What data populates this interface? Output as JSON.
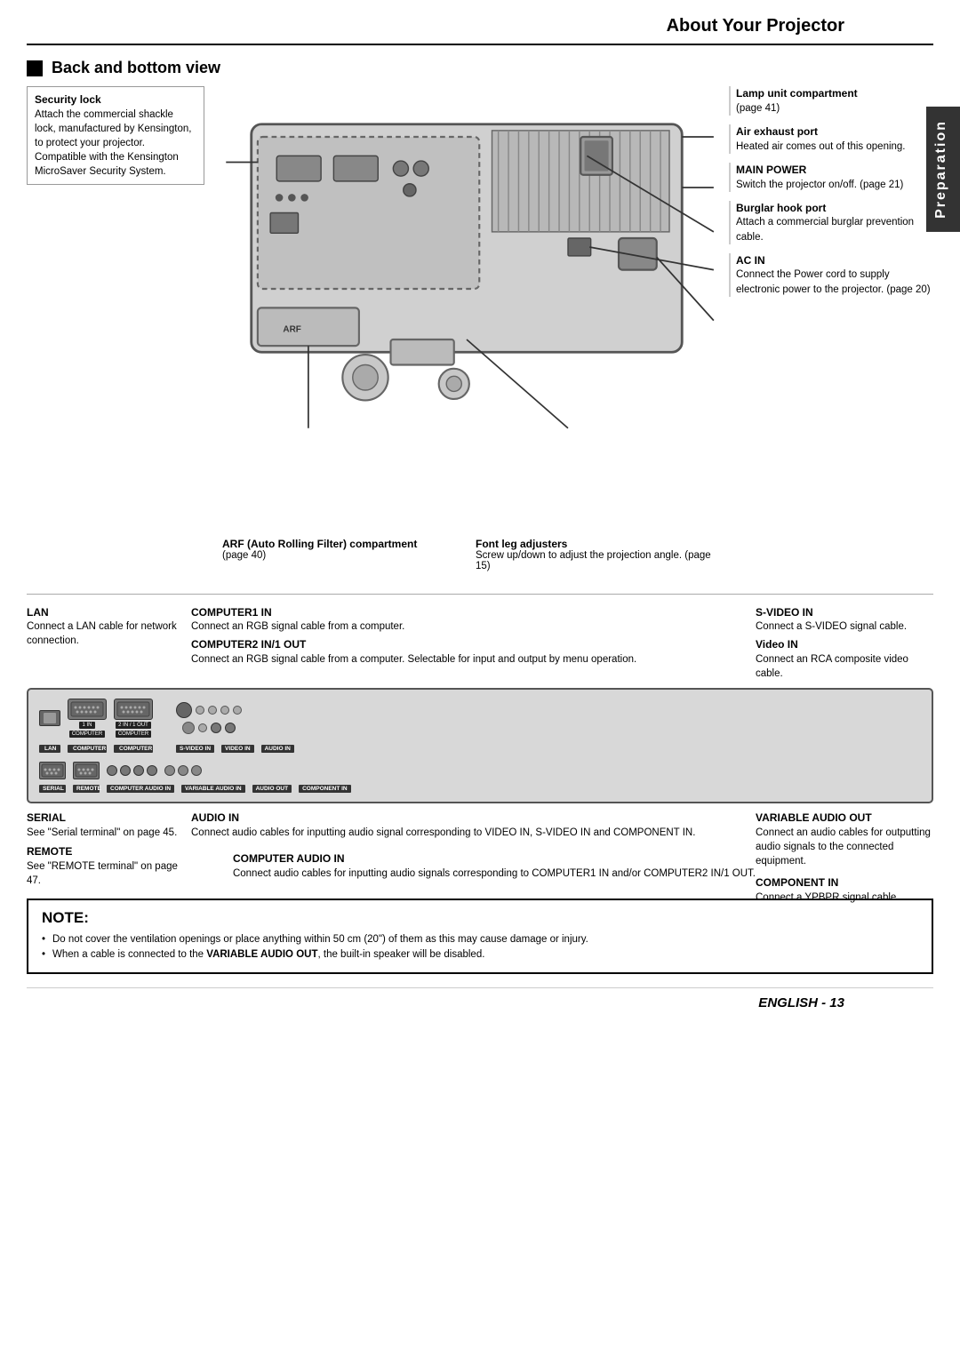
{
  "header": {
    "title": "About Your Projector"
  },
  "side_tab": {
    "label": "Preparation"
  },
  "section": {
    "title": "Back and bottom view"
  },
  "left_annotations": [
    {
      "id": "security-lock",
      "title": "Security lock",
      "text": "Attach the commercial shackle lock, manufactured by Kensington, to protect your projector. Compatible with the Kensington MicroSaver Security System."
    }
  ],
  "right_annotations": [
    {
      "id": "lamp-unit",
      "title": "Lamp unit compartment",
      "text": "(page 41)"
    },
    {
      "id": "air-exhaust",
      "title": "Air exhaust port",
      "text": "Heated air comes out of this opening."
    },
    {
      "id": "main-power",
      "title": "MAIN POWER",
      "text": "Switch the projector on/off. (page 21)"
    },
    {
      "id": "burglar-hook",
      "title": "Burglar hook port",
      "text": "Attach a commercial burglar prevention cable."
    },
    {
      "id": "ac-in",
      "title": "AC IN",
      "text": "Connect the Power cord to supply electronic power to the projector. (page 20)"
    }
  ],
  "bottom_labels": [
    {
      "id": "arf",
      "title": "ARF (Auto Rolling Filter) compartment",
      "text": "(page 40)"
    },
    {
      "id": "font-leg",
      "title": "Font leg adjusters",
      "text": "Screw up/down to adjust the projection angle. (page 15)"
    }
  ],
  "connector_top_labels": [
    {
      "id": "lan",
      "title": "LAN",
      "text": "Connect a LAN cable for network connection."
    },
    {
      "id": "computer1in",
      "title": "COMPUTER1 IN",
      "text": "Connect an RGB signal cable from a computer."
    },
    {
      "id": "computer2",
      "title": "COMPUTER2 IN/1 OUT",
      "text": "Connect an RGB signal cable from a computer. Selectable for input and output by menu operation."
    },
    {
      "id": "svideo",
      "title": "S-VIDEO IN",
      "text": "Connect a S-VIDEO signal cable."
    },
    {
      "id": "videoin",
      "title": "Video IN",
      "text": "Connect an RCA composite video cable."
    }
  ],
  "connector_bottom_labels": [
    {
      "id": "serial",
      "title": "SERIAL",
      "text": "See \"Serial terminal\" on page 45."
    },
    {
      "id": "remote",
      "title": "REMOTE",
      "text": "See \"REMOTE terminal\" on page 47."
    },
    {
      "id": "audio-in-label",
      "title": "AUDIO IN",
      "text": "Connect audio cables for inputting audio signal corresponding to VIDEO IN, S-VIDEO IN and COMPONENT IN."
    },
    {
      "id": "computer-audio-in",
      "title": "COMPUTER AUDIO IN",
      "text": "Connect audio cables for inputting audio signals corresponding to COMPUTER1 IN and/or COMPUTER2 IN/1 OUT."
    },
    {
      "id": "variable-audio-out",
      "title": "VARIABLE AUDIO OUT",
      "text": "Connect an audio cables for outputting audio signals to the connected equipment."
    },
    {
      "id": "component-in",
      "title": "COMPONENT IN",
      "text": "Connect a YPBPR signal cable."
    }
  ],
  "note": {
    "title": "NOTE:",
    "items": [
      "Do not cover the ventilation openings or place anything within 50 cm (20\") of them as this may cause damage or injury.",
      "When a cable is connected to the VARIABLE AUDIO OUT, the built-in speaker will be disabled."
    ]
  },
  "footer": {
    "prefix": "E",
    "text": "NGLISH - 13"
  },
  "port_labels": {
    "lan": "LAN",
    "computer1": "1 IN\nCOMPUTER",
    "computer2": "2 IN / 1 OUT\nCOMPUTER",
    "serial": "SERIAL",
    "remote": "REMOTE",
    "variable_audio_in": "VARIABLE\nAUDIO IN",
    "variable_audio_out": "AUDIO OUT",
    "svideo_in": "S-VIDEO IN\nVIDEO IN",
    "component_in": "COMPONENT IN",
    "audio_in": "AUDIO IN"
  }
}
